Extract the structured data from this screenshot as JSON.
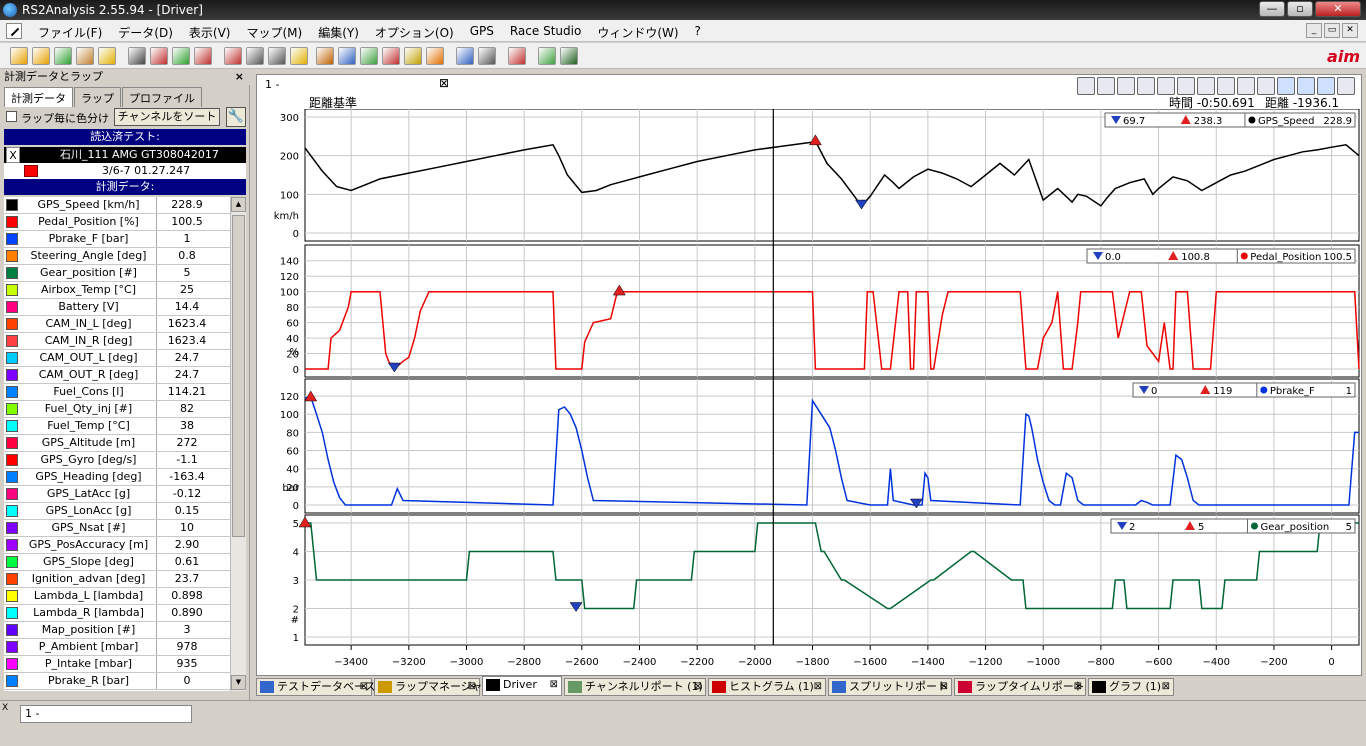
{
  "window": {
    "title": "RS2Analysis 2.55.94 - [Driver]"
  },
  "menu": [
    "ファイル(F)",
    "データ(D)",
    "表示(V)",
    "マップ(M)",
    "編集(Y)",
    "オプション(O)",
    "GPS",
    "Race Studio",
    "ウィンドウ(W)",
    "?"
  ],
  "left_panel": {
    "title": "計測データとラップ",
    "tabs": [
      "計測データ",
      "ラップ",
      "プロファイル"
    ],
    "color_by_lap": "ラップ毎に色分け",
    "sort_button": "チャンネルをソート",
    "loaded_header": "読込済テスト:",
    "test_x": "X",
    "test_name": "石川_111 AMG GT308042017",
    "test_date": "3/6-7 01.27.247",
    "data_header": "計測データ:",
    "channels": [
      {
        "name": "GPS_Speed",
        "unit": "[km/h]",
        "value": "228.9",
        "color": "#000000"
      },
      {
        "name": "Pedal_Position",
        "unit": "[%]",
        "value": "100.5",
        "color": "#ff0000"
      },
      {
        "name": "Pbrake_F",
        "unit": "[bar]",
        "value": "1",
        "color": "#0044ff"
      },
      {
        "name": "Steering_Angle",
        "unit": "[deg]",
        "value": "0.8",
        "color": "#ff8000"
      },
      {
        "name": "Gear_position",
        "unit": "[#]",
        "value": "5",
        "color": "#008040"
      },
      {
        "name": "Airbox_Temp",
        "unit": "[°C]",
        "value": "25",
        "color": "#c8ff00"
      },
      {
        "name": "Battery",
        "unit": "[V]",
        "value": "14.4",
        "color": "#ff0080"
      },
      {
        "name": "CAM_IN_L",
        "unit": "[deg]",
        "value": "1623.4",
        "color": "#ff4000"
      },
      {
        "name": "CAM_IN_R",
        "unit": "[deg]",
        "value": "1623.4",
        "color": "#ff4040"
      },
      {
        "name": "CAM_OUT_L",
        "unit": "[deg]",
        "value": "24.7",
        "color": "#00ccff"
      },
      {
        "name": "CAM_OUT_R",
        "unit": "[deg]",
        "value": "24.7",
        "color": "#8000ff"
      },
      {
        "name": "Fuel_Cons",
        "unit": "[l]",
        "value": "114.21",
        "color": "#0080ff"
      },
      {
        "name": "Fuel_Qty_inj",
        "unit": "[#]",
        "value": "82",
        "color": "#80ff00"
      },
      {
        "name": "Fuel_Temp",
        "unit": "[°C]",
        "value": "38",
        "color": "#00ffff"
      },
      {
        "name": "GPS_Altitude",
        "unit": "[m]",
        "value": "272",
        "color": "#ff0040"
      },
      {
        "name": "GPS_Gyro",
        "unit": "[deg/s]",
        "value": "-1.1",
        "color": "#ff0000"
      },
      {
        "name": "GPS_Heading",
        "unit": "[deg]",
        "value": "-163.4",
        "color": "#0080ff"
      },
      {
        "name": "GPS_LatAcc",
        "unit": "[g]",
        "value": "-0.12",
        "color": "#ff0080"
      },
      {
        "name": "GPS_LonAcc",
        "unit": "[g]",
        "value": "0.15",
        "color": "#00ffff"
      },
      {
        "name": "GPS_Nsat",
        "unit": "[#]",
        "value": "10",
        "color": "#8000ff"
      },
      {
        "name": "GPS_PosAccuracy",
        "unit": "[m]",
        "value": "2.90",
        "color": "#a000ff"
      },
      {
        "name": "GPS_Slope",
        "unit": "[deg]",
        "value": "0.61",
        "color": "#00ff40"
      },
      {
        "name": "Ignition_advan",
        "unit": "[deg]",
        "value": "23.7",
        "color": "#ff4000"
      },
      {
        "name": "Lambda_L",
        "unit": "[lambda]",
        "value": "0.898",
        "color": "#ffff00"
      },
      {
        "name": "Lambda_R",
        "unit": "[lambda]",
        "value": "0.890",
        "color": "#00ffff"
      },
      {
        "name": "Map_position",
        "unit": "[#]",
        "value": "3",
        "color": "#6000ff"
      },
      {
        "name": "P_Ambient",
        "unit": "[mbar]",
        "value": "978",
        "color": "#8000ff"
      },
      {
        "name": "P_Intake",
        "unit": "[mbar]",
        "value": "935",
        "color": "#ff00ff"
      },
      {
        "name": "Pbrake_R",
        "unit": "[bar]",
        "value": "0",
        "color": "#0080ff"
      }
    ]
  },
  "main": {
    "doc_tab": "1 - ",
    "reference": "距離基準",
    "time": "時間 -0:50.691",
    "distance": "距離 -1936.1 [m]"
  },
  "bottom_tabs": [
    {
      "label": "テストデータベース",
      "color": "#3366cc"
    },
    {
      "label": "ラップマネージャ",
      "color": "#cc9900"
    },
    {
      "label": "Driver",
      "color": "#000000"
    },
    {
      "label": "チャンネルリポート (1)",
      "color": "#669966"
    },
    {
      "label": "ヒストグラム (1)",
      "color": "#cc0000"
    },
    {
      "label": "スプリットリポート",
      "color": "#3366cc"
    },
    {
      "label": "ラップタイムリポート",
      "color": "#cc0033"
    },
    {
      "label": "グラフ (1)",
      "color": "#000000"
    }
  ],
  "status": {
    "x": "X",
    "item": "1 - "
  },
  "chart_data": {
    "type": "line",
    "x_label": "",
    "x_ticks": [
      -3400,
      -3200,
      -3000,
      -2800,
      -2600,
      -2400,
      -2200,
      -2000,
      -1800,
      -1600,
      -1400,
      -1200,
      -1000,
      -800,
      -600,
      -400,
      -200,
      0
    ],
    "xlim": [
      -3560,
      95
    ],
    "cursor_x": -1936,
    "panels": [
      {
        "name": "GPS_Speed",
        "unit_label": "km/h",
        "color": "#000000",
        "ylim": [
          0,
          300
        ],
        "y_ticks": [
          "300",
          "200",
          "100",
          "0"
        ],
        "min": "69.7",
        "max": "238.3",
        "value": "228.9",
        "min_at": [
          -1630,
          69.7
        ],
        "max_at": [
          -1790,
          238.3
        ],
        "x": [
          -3560,
          -3500,
          -3450,
          -3400,
          -3350,
          -3300,
          -3200,
          -3100,
          -3000,
          -2900,
          -2800,
          -2700,
          -2680,
          -2650,
          -2600,
          -2550,
          -2500,
          -2400,
          -2300,
          -2200,
          -2100,
          -2000,
          -1900,
          -1800,
          -1790,
          -1750,
          -1700,
          -1650,
          -1630,
          -1600,
          -1550,
          -1520,
          -1500,
          -1450,
          -1400,
          -1350,
          -1300,
          -1250,
          -1200,
          -1150,
          -1100,
          -1050,
          -1000,
          -950,
          -900,
          -880,
          -850,
          -800,
          -780,
          -750,
          -700,
          -650,
          -620,
          -600,
          -550,
          -500,
          -450,
          -400,
          -350,
          -300,
          -250,
          -200,
          -150,
          -100,
          -50,
          0,
          50,
          95
        ],
        "y": [
          220,
          160,
          120,
          110,
          125,
          140,
          155,
          170,
          185,
          200,
          215,
          228,
          200,
          150,
          105,
          110,
          125,
          145,
          165,
          185,
          200,
          215,
          225,
          235,
          238,
          180,
          140,
          90,
          70,
          95,
          150,
          130,
          115,
          145,
          165,
          155,
          140,
          120,
          150,
          180,
          150,
          190,
          85,
          115,
          80,
          100,
          95,
          70,
          90,
          115,
          130,
          140,
          100,
          115,
          145,
          135,
          110,
          130,
          150,
          160,
          175,
          190,
          200,
          210,
          215,
          222,
          228,
          200
        ]
      },
      {
        "name": "Pedal_Position",
        "unit_label": "%",
        "color": "#ee0000",
        "ylim": [
          0,
          150
        ],
        "y_ticks": [
          "140",
          "120",
          "100",
          "80",
          "60",
          "40",
          "20",
          "0"
        ],
        "min": "0.0",
        "max": "100.8",
        "value": "100.5",
        "min_at": [
          -3250,
          0
        ],
        "max_at": [
          -2470,
          100.8
        ],
        "x": [
          -3560,
          -3480,
          -3470,
          -3440,
          -3420,
          -3410,
          -3400,
          -3350,
          -3300,
          -3280,
          -3270,
          -3250,
          -3220,
          -3200,
          -3180,
          -3160,
          -3130,
          -3120,
          -3100,
          -3000,
          -2700,
          -2690,
          -2600,
          -2590,
          -2560,
          -2500,
          -2480,
          -2470,
          -2000,
          -1800,
          -1790,
          -1760,
          -1750,
          -1700,
          -1680,
          -1620,
          -1610,
          -1590,
          -1560,
          -1530,
          -1500,
          -1470,
          -1460,
          -1450,
          -1440,
          -1400,
          -1390,
          -1380,
          -1350,
          -1330,
          -1320,
          -1300,
          -1080,
          -1060,
          -1020,
          -1000,
          -970,
          -950,
          -930,
          -900,
          -880,
          -870,
          -850,
          -830,
          -810,
          -800,
          -760,
          -740,
          -700,
          -680,
          -660,
          -640,
          -620,
          -600,
          -580,
          -560,
          -550,
          -540,
          -520,
          -500,
          -480,
          -460,
          -420,
          -400,
          -380,
          -60,
          -20,
          0,
          30,
          60,
          80,
          95
        ],
        "y": [
          0,
          0,
          40,
          50,
          70,
          80,
          100,
          100,
          100,
          20,
          10,
          0,
          10,
          15,
          40,
          75,
          100,
          100,
          100,
          100,
          100,
          0,
          0,
          35,
          60,
          65,
          95,
          100,
          100,
          100,
          0,
          0,
          0,
          0,
          0,
          0,
          100,
          100,
          0,
          0,
          100,
          100,
          0,
          0,
          100,
          100,
          0,
          0,
          70,
          100,
          100,
          100,
          100,
          0,
          0,
          40,
          60,
          100,
          0,
          0,
          60,
          100,
          100,
          100,
          100,
          100,
          100,
          40,
          100,
          100,
          100,
          30,
          20,
          10,
          60,
          0,
          0,
          100,
          100,
          100,
          0,
          0,
          0,
          100,
          100,
          100,
          100,
          100,
          100,
          100,
          100,
          0
        ]
      },
      {
        "name": "Pbrake_F",
        "unit_label": "bar",
        "color": "#0033dd",
        "ylim": [
          0,
          130
        ],
        "y_ticks": [
          "120",
          "100",
          "80",
          "60",
          "40",
          "20",
          "0"
        ],
        "min": "0",
        "max": "119",
        "value": "1",
        "min_at": [
          -1440,
          0
        ],
        "max_at": [
          -3540,
          119
        ],
        "x": [
          -3560,
          -3540,
          -3520,
          -3500,
          -3480,
          -3460,
          -3440,
          -3420,
          -3300,
          -3260,
          -3240,
          -3220,
          -2700,
          -2680,
          -2660,
          -2640,
          -2620,
          -2600,
          -2580,
          -2560,
          -1820,
          -1800,
          -1780,
          -1760,
          -1740,
          -1720,
          -1700,
          -1680,
          -1600,
          -1540,
          -1530,
          -1520,
          -1450,
          -1420,
          -1410,
          -1400,
          -1390,
          -1080,
          -1060,
          -1050,
          -1040,
          -1020,
          -1000,
          -980,
          -960,
          -940,
          -920,
          -900,
          -880,
          -860,
          -700,
          -680,
          -660,
          -640,
          -620,
          -560,
          -540,
          -520,
          -500,
          -480,
          -460,
          -440,
          -420,
          -40,
          -20,
          0,
          20,
          40,
          60,
          80,
          95
        ],
        "y": [
          118,
          119,
          100,
          80,
          50,
          25,
          8,
          0,
          0,
          0,
          18,
          5,
          0,
          105,
          108,
          100,
          85,
          60,
          30,
          5,
          0,
          115,
          105,
          95,
          85,
          60,
          30,
          5,
          0,
          0,
          40,
          5,
          0,
          0,
          35,
          30,
          5,
          0,
          100,
          98,
          85,
          50,
          25,
          5,
          0,
          0,
          35,
          30,
          5,
          0,
          0,
          0,
          5,
          3,
          0,
          0,
          55,
          50,
          30,
          5,
          0,
          0,
          0,
          0,
          0,
          0,
          0,
          0,
          0,
          80,
          80
        ]
      },
      {
        "name": "Gear_position",
        "unit_label": "#",
        "color": "#006633",
        "ylim": [
          1,
          5
        ],
        "y_ticks": [
          "5",
          "4",
          "3",
          "2",
          "1"
        ],
        "min": "2",
        "max": "5",
        "value": "5",
        "min_at": [
          -2620,
          2
        ],
        "max_at": [
          -3560,
          5
        ],
        "x": [
          -3560,
          -3550,
          -3540,
          -3520,
          -3000,
          -2990,
          -2700,
          -2690,
          -2600,
          -2590,
          -2420,
          -2410,
          -2220,
          -2210,
          -2000,
          -1990,
          -1790,
          -1770,
          -1760,
          -1700,
          -1690,
          -1540,
          -1530,
          -1390,
          -1380,
          -1250,
          -1240,
          -1110,
          -1100,
          -1070,
          -1060,
          -760,
          -750,
          -720,
          -710,
          -560,
          -550,
          -460,
          -450,
          -380,
          -370,
          -260,
          -250,
          -50,
          -40,
          95
        ],
        "y": [
          5,
          5,
          5,
          3,
          3,
          4,
          4,
          3,
          3,
          2,
          2,
          3,
          3,
          4,
          4,
          5,
          5,
          4,
          4,
          3,
          3,
          2,
          2,
          3,
          3,
          4,
          4,
          3,
          3,
          3,
          2,
          2,
          3,
          3,
          2,
          2,
          3,
          3,
          2,
          2,
          3,
          3,
          4,
          4,
          5,
          5
        ]
      }
    ]
  }
}
